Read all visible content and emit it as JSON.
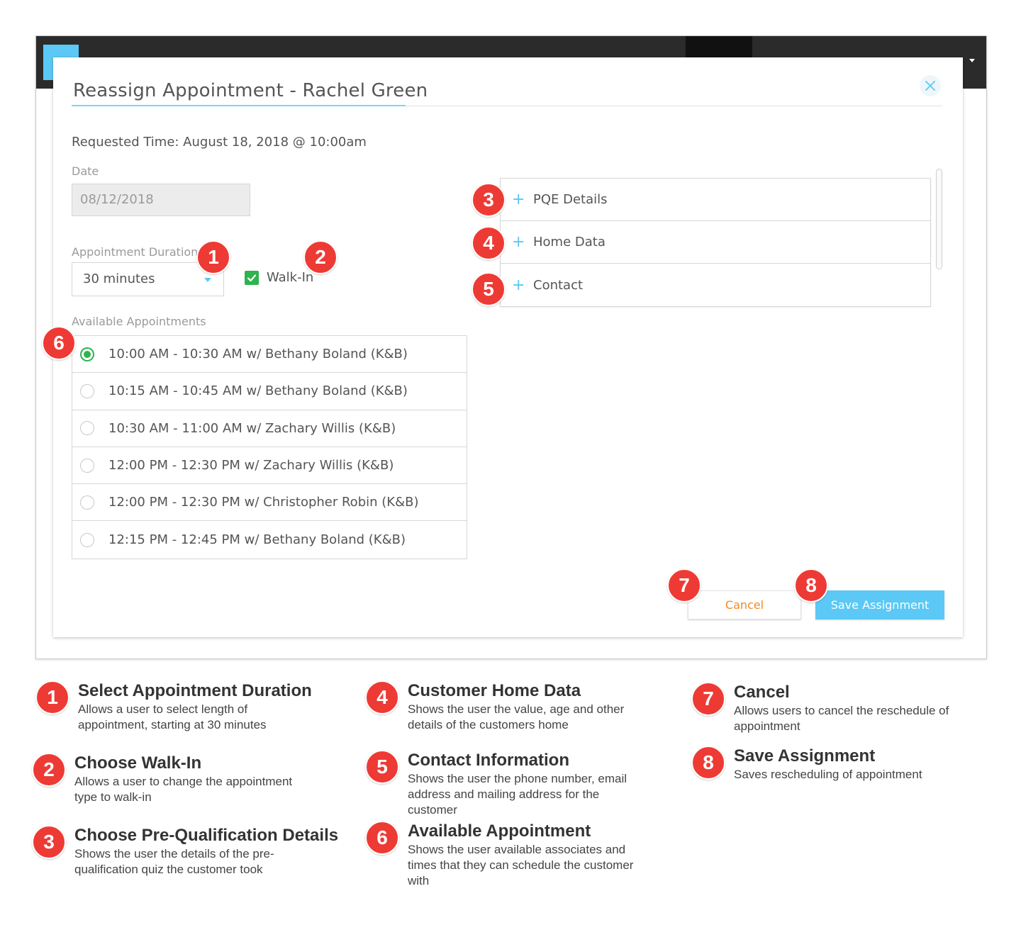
{
  "modal": {
    "title": "Reassign Appointment - Rachel Green",
    "requested_time": "Requested Time: August 18, 2018 @ 10:00am",
    "date_label": "Date",
    "date_value": "08/12/2018",
    "duration_label": "Appointment Duration",
    "duration_value": "30 minutes",
    "walkin_label": "Walk-In",
    "walkin_checked": true,
    "available_label": "Available Appointments",
    "appointments": [
      {
        "label": "10:00 AM - 10:30 AM w/ Bethany Boland (K&B)",
        "selected": true
      },
      {
        "label": "10:15 AM - 10:45 AM w/ Bethany Boland (K&B)",
        "selected": false
      },
      {
        "label": "10:30 AM - 11:00 AM w/ Zachary Willis (K&B)",
        "selected": false
      },
      {
        "label": "12:00 PM - 12:30 PM w/ Zachary Willis (K&B)",
        "selected": false
      },
      {
        "label": "12:00 PM - 12:30 PM w/ Christopher Robin (K&B)",
        "selected": false
      },
      {
        "label": "12:15 PM - 12:45 PM w/ Bethany Boland (K&B)",
        "selected": false
      }
    ],
    "accordion": [
      {
        "label": "PQE Details",
        "icon": "plus-icon"
      },
      {
        "label": "Home Data",
        "icon": "plus-icon"
      },
      {
        "label": "Contact",
        "icon": "plus-icon"
      }
    ],
    "cancel_label": "Cancel",
    "save_label": "Save Assignment"
  },
  "callouts": [
    "1",
    "2",
    "3",
    "4",
    "5",
    "6",
    "7",
    "8"
  ],
  "legend": [
    {
      "num": "1",
      "title": "Select Appointment Duration",
      "desc": "Allows a user to select length of appointment, starting at 30 minutes"
    },
    {
      "num": "2",
      "title": "Choose Walk-In",
      "desc": "Allows a user to change the appointment type to walk-in"
    },
    {
      "num": "3",
      "title": "Choose Pre-Qualification Details",
      "desc": "Shows the user the details of the pre-qualification quiz the customer took"
    },
    {
      "num": "4",
      "title": "Customer Home Data",
      "desc": "Shows the user the value, age and other details of the customers home"
    },
    {
      "num": "5",
      "title": "Contact Information",
      "desc": "Shows the user the phone number, email address and mailing address for the customer"
    },
    {
      "num": "6",
      "title": "Available Appointment",
      "desc": "Shows the user available associates and times that they can schedule the customer with"
    },
    {
      "num": "7",
      "title": "Cancel",
      "desc": "Allows users to cancel the reschedule of appointment"
    },
    {
      "num": "8",
      "title": "Save Assignment",
      "desc": "Saves rescheduling of appointment"
    }
  ],
  "colors": {
    "accent": "#5bc8f5",
    "success": "#2eb34f",
    "callout": "#ee3a34",
    "cancel_text": "#f08a24",
    "topbar": "#2b2b2b"
  }
}
